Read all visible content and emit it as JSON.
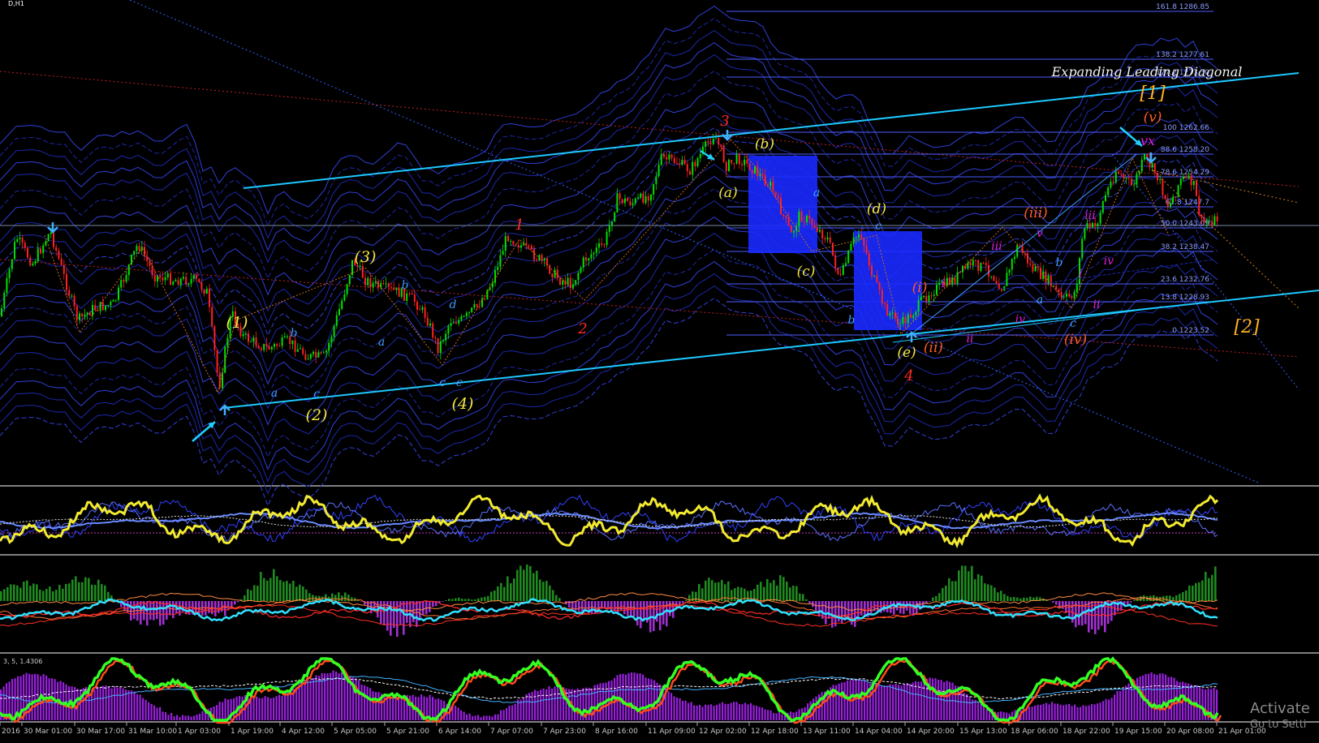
{
  "window": {
    "title_fragment": "D,H1"
  },
  "main_chart": {
    "annotation": "Expanding Leading Diagonal",
    "fib_levels": [
      {
        "label": "161.8 1286.85"
      },
      {
        "label": "138.2 1277.61"
      },
      {
        "label": "127.2 1273.30"
      },
      {
        "label": "100 1262.66"
      },
      {
        "label": "88.6 1258.20"
      },
      {
        "label": "78.6 1254.29"
      },
      {
        "label": "61.8 1247.7"
      },
      {
        "label": "50.0 1243.09"
      },
      {
        "label": "38.2 1238.47"
      },
      {
        "label": "23.6 1232.76"
      },
      {
        "label": "13.8 1228.93"
      },
      {
        "label": "0 1223.52"
      }
    ],
    "wave_labels": {
      "w1_red": "1",
      "w2_red": "2",
      "w3_red": "3",
      "w4_red": "4",
      "p1": "(1)",
      "p2": "(2)",
      "p3": "(3)",
      "p4": "(4)",
      "pa": "(a)",
      "pb": "(b)",
      "pc": "(c)",
      "pd": "(d)",
      "pe": "(e)",
      "pi": "(i)",
      "pii": "(ii)",
      "piii": "(iii)",
      "piv": "(iv)",
      "pv": "(v)",
      "big1": "[1]",
      "big2": "[2]",
      "a1": "a",
      "b1": "b",
      "c1": "c",
      "a2": "a",
      "b2": "b",
      "c2a": "c",
      "c2b": "e",
      "d2": "d",
      "a3": "a",
      "b3": "b",
      "c3": "c",
      "i1": "i",
      "ii1": "ii",
      "iii1": "iii",
      "iv1": "iv",
      "v1": "v",
      "i2": "i",
      "ii2": "ii",
      "iii2": "iii",
      "iv2": "iv",
      "vx": "vx",
      "a4": "a",
      "b4": "b",
      "c4": "c"
    }
  },
  "time_axis": {
    "labels": [
      "2016",
      "30 Mar 01:00",
      "30 Mar 17:00",
      "31 Mar 10:00",
      "1 Apr 03:00",
      "1 Apr 19:00",
      "4 Apr 12:00",
      "5 Apr 05:00",
      "5 Apr 21:00",
      "6 Apr 14:00",
      "7 Apr 07:00",
      "7 Apr 23:00",
      "8 Apr 16:00",
      "11 Apr 09:00",
      "12 Apr 02:00",
      "12 Apr 18:00",
      "13 Apr 11:00",
      "14 Apr 04:00",
      "14 Apr 20:00",
      "15 Apr 13:00",
      "18 Apr 06:00",
      "18 Apr 22:00",
      "19 Apr 15:00",
      "20 Apr 08:00",
      "21 Apr 01:00"
    ]
  },
  "indicator_labels": {
    "sub1": "",
    "sub3": "3, 5, 1.4306"
  },
  "watermark": {
    "line1": "Activate",
    "line2": "Go to Setti"
  },
  "colors": {
    "background": "#000000",
    "bull": "#00e000",
    "bear": "#ff2020",
    "trend": "#1ec8ff",
    "fib": "#4d5cff",
    "wave_yellow": "#f5e642",
    "wave_red": "#ff2a2a",
    "wave_blue": "#3f9bff",
    "wave_magenta": "#e020e0",
    "wave_orange": "#ff5a2a",
    "box": "#1a2aff"
  }
}
